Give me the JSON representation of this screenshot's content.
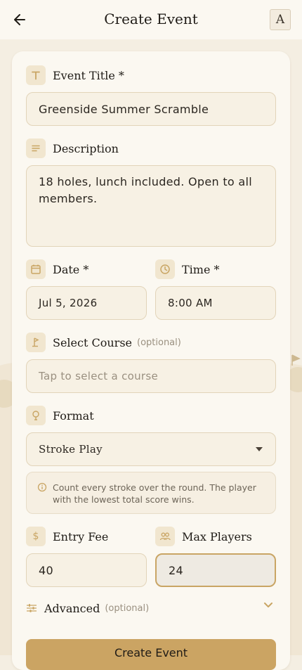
{
  "header": {
    "title": "Create Event",
    "avatar_letter": "A"
  },
  "form": {
    "title_label": "Event Title *",
    "title_value": "Greenside Summer Scramble",
    "description_label": "Description",
    "description_value": "18 holes, lunch included. Open to all members.",
    "date_label": "Date *",
    "date_value": "Jul 5, 2026",
    "time_label": "Time *",
    "time_value": "8:00 AM",
    "course_label": "Select Course",
    "course_optional": "(optional)",
    "course_placeholder": "Tap to select a course",
    "format_label": "Format",
    "format_value": "Stroke Play",
    "format_info": "Count every stroke over the round. The player with the lowest total score wins.",
    "entry_fee_label": "Entry Fee",
    "entry_fee_value": "40",
    "max_players_label": "Max Players",
    "max_players_value": "24",
    "advanced_label": "Advanced",
    "advanced_optional": "(optional)",
    "submit_label": "Create Event"
  },
  "colors": {
    "accent": "#cba463",
    "icon": "#c9a564",
    "background": "#f4eee2",
    "card": "#fbf8f1"
  }
}
